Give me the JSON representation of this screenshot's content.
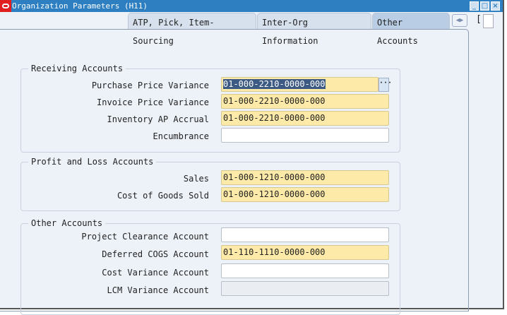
{
  "window": {
    "title": "Organization Parameters (H11)",
    "controls": {
      "minimize": "minimize-icon",
      "maximize": "maximize-icon",
      "close": "close-icon"
    }
  },
  "tabs": [
    {
      "label": "ATP, Pick, Item-Sourcing",
      "active": false
    },
    {
      "label": "Inter-Org Information",
      "active": false
    },
    {
      "label": "Other Accounts",
      "active": true
    }
  ],
  "bracket": "[",
  "colors": {
    "titlebar": "#2d7fc1",
    "required_field": "#fdeaa8",
    "selection": "#3c5a84",
    "background": "#edf1f8"
  },
  "groups": {
    "receiving": {
      "label": "Receiving Accounts",
      "fields": [
        {
          "label": "Purchase Price Variance",
          "value": "01-000-2210-0000-000",
          "required": true,
          "selected": true
        },
        {
          "label": "Invoice Price Variance",
          "value": "01-000-2210-0000-000",
          "required": true
        },
        {
          "label": "Inventory AP Accrual",
          "value": "01-000-2210-0000-000",
          "required": true
        },
        {
          "label": "Encumbrance",
          "value": ""
        }
      ]
    },
    "profit_loss": {
      "label": "Profit and Loss Accounts",
      "fields": [
        {
          "label": "Sales",
          "value": "01-000-1210-0000-000",
          "required": true
        },
        {
          "label": "Cost of Goods Sold",
          "value": "01-000-1210-0000-000",
          "required": true
        }
      ]
    },
    "other": {
      "label": "Other Accounts",
      "fields": [
        {
          "label": "Project Clearance Account",
          "value": ""
        },
        {
          "label": "Deferred COGS Account",
          "value": "01-110-1110-0000-000",
          "required": true
        },
        {
          "label": "Cost Variance Account",
          "value": ""
        },
        {
          "label": "LCM Variance Account",
          "value": "",
          "readonly": true
        }
      ]
    }
  }
}
